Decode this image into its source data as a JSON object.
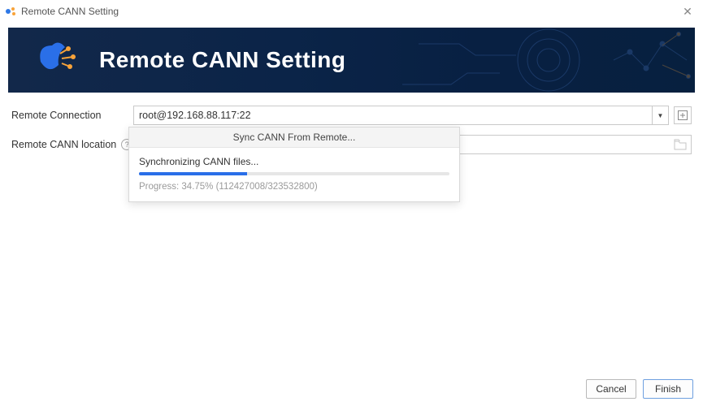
{
  "window": {
    "title": "Remote CANN Setting",
    "close_glyph": "✕"
  },
  "banner": {
    "title": "Remote CANN Setting"
  },
  "form": {
    "remote_connection": {
      "label": "Remote Connection",
      "value": "root@192.168.88.117:22"
    },
    "remote_location": {
      "label": "Remote CANN location",
      "value": ""
    }
  },
  "progress": {
    "title": "Sync CANN From Remote...",
    "message": "Synchronizing CANN files...",
    "percent": 34.75,
    "done_bytes": 112427008,
    "total_bytes": 323532800,
    "text": "Progress: 34.75% (112427008/323532800)"
  },
  "footer": {
    "cancel": "Cancel",
    "finish": "Finish"
  }
}
